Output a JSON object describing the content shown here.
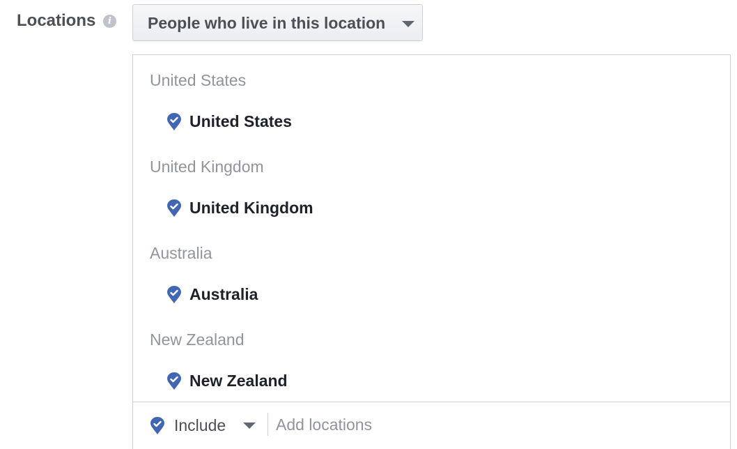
{
  "locations_field": {
    "label": "Locations",
    "info_icon": "info-icon",
    "type_dropdown": {
      "selected": "People who live in this location"
    }
  },
  "groups": [
    {
      "header": "United States",
      "items": [
        {
          "name": "United States",
          "icon": "location-pin-check-icon"
        }
      ]
    },
    {
      "header": "United Kingdom",
      "items": [
        {
          "name": "United Kingdom",
          "icon": "location-pin-check-icon"
        }
      ]
    },
    {
      "header": "Australia",
      "items": [
        {
          "name": "Australia",
          "icon": "location-pin-check-icon"
        }
      ]
    },
    {
      "header": "New Zealand",
      "items": [
        {
          "name": "New Zealand",
          "icon": "location-pin-check-icon"
        }
      ]
    }
  ],
  "bottom_bar": {
    "include_label": "Include",
    "include_icon": "location-pin-check-icon",
    "add_placeholder": "Add locations"
  },
  "colors": {
    "pin": "#4267b2",
    "label": "#4b4f56",
    "muted": "#90949c",
    "border": "#ccd0d5"
  }
}
